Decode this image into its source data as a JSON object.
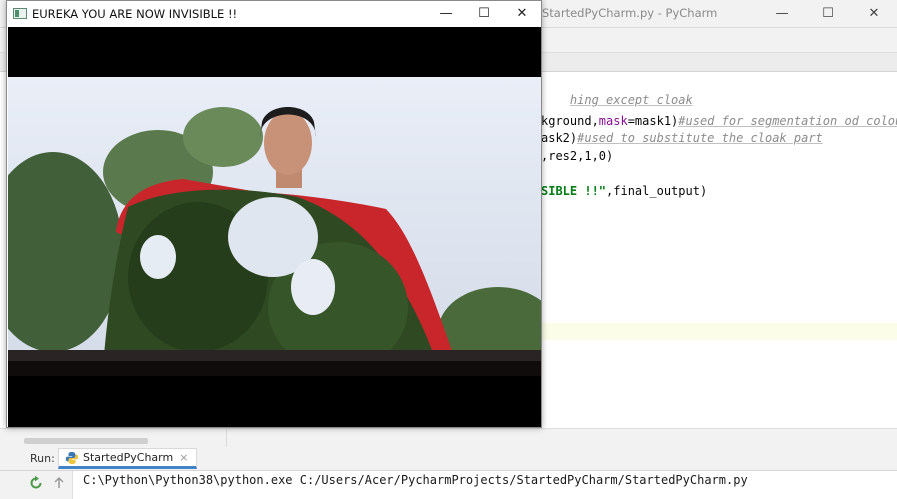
{
  "ide": {
    "title": "StartedPyCharm.py - PyCharm",
    "window_controls": [
      "—",
      "☐",
      "✕"
    ],
    "code_lines": [
      {
        "segments": [
          {
            "t": "hing except cloak",
            "c": "cm"
          }
        ]
      },
      {
        "segments": [
          {
            "t": "kground,",
            "c": ""
          },
          {
            "t": "mask",
            "c": "kw"
          },
          {
            "t": "=mask1)",
            "c": ""
          },
          {
            "t": "#used for segmentation od colour",
            "c": "cm"
          }
        ]
      },
      {
        "segments": [
          {
            "t": "ask2)",
            "c": ""
          },
          {
            "t": "#used to substitute the cloak part",
            "c": "cm"
          }
        ]
      },
      {
        "segments": [
          {
            "t": ",res2,1,0)",
            "c": ""
          }
        ]
      },
      {
        "segments": [
          {
            "t": "SIBLE !!\"",
            "c": "st"
          },
          {
            "t": ",final_output)",
            "c": ""
          }
        ]
      }
    ]
  },
  "run": {
    "label": "Run:",
    "tab_label": "StartedPyCharm",
    "tab_close": "×",
    "console_text": "C:\\Python\\Python38\\python.exe C:/Users/Acer/PycharmProjects/StartedPyCharm/StartedPyCharm.py"
  },
  "cv_window": {
    "title": "EUREKA YOU ARE NOW INVISIBLE !!",
    "controls": [
      "—",
      "☐",
      "✕"
    ],
    "icons": {
      "app": "opencv-window-icon"
    }
  },
  "colors": {
    "cloak_red": "#c8262b",
    "sky": "#dfe6f2",
    "foliage": "#2f4a22",
    "comment": "#8c8c8c",
    "keyword": "#871094",
    "string": "#067d17",
    "accent": "#4083c9"
  }
}
